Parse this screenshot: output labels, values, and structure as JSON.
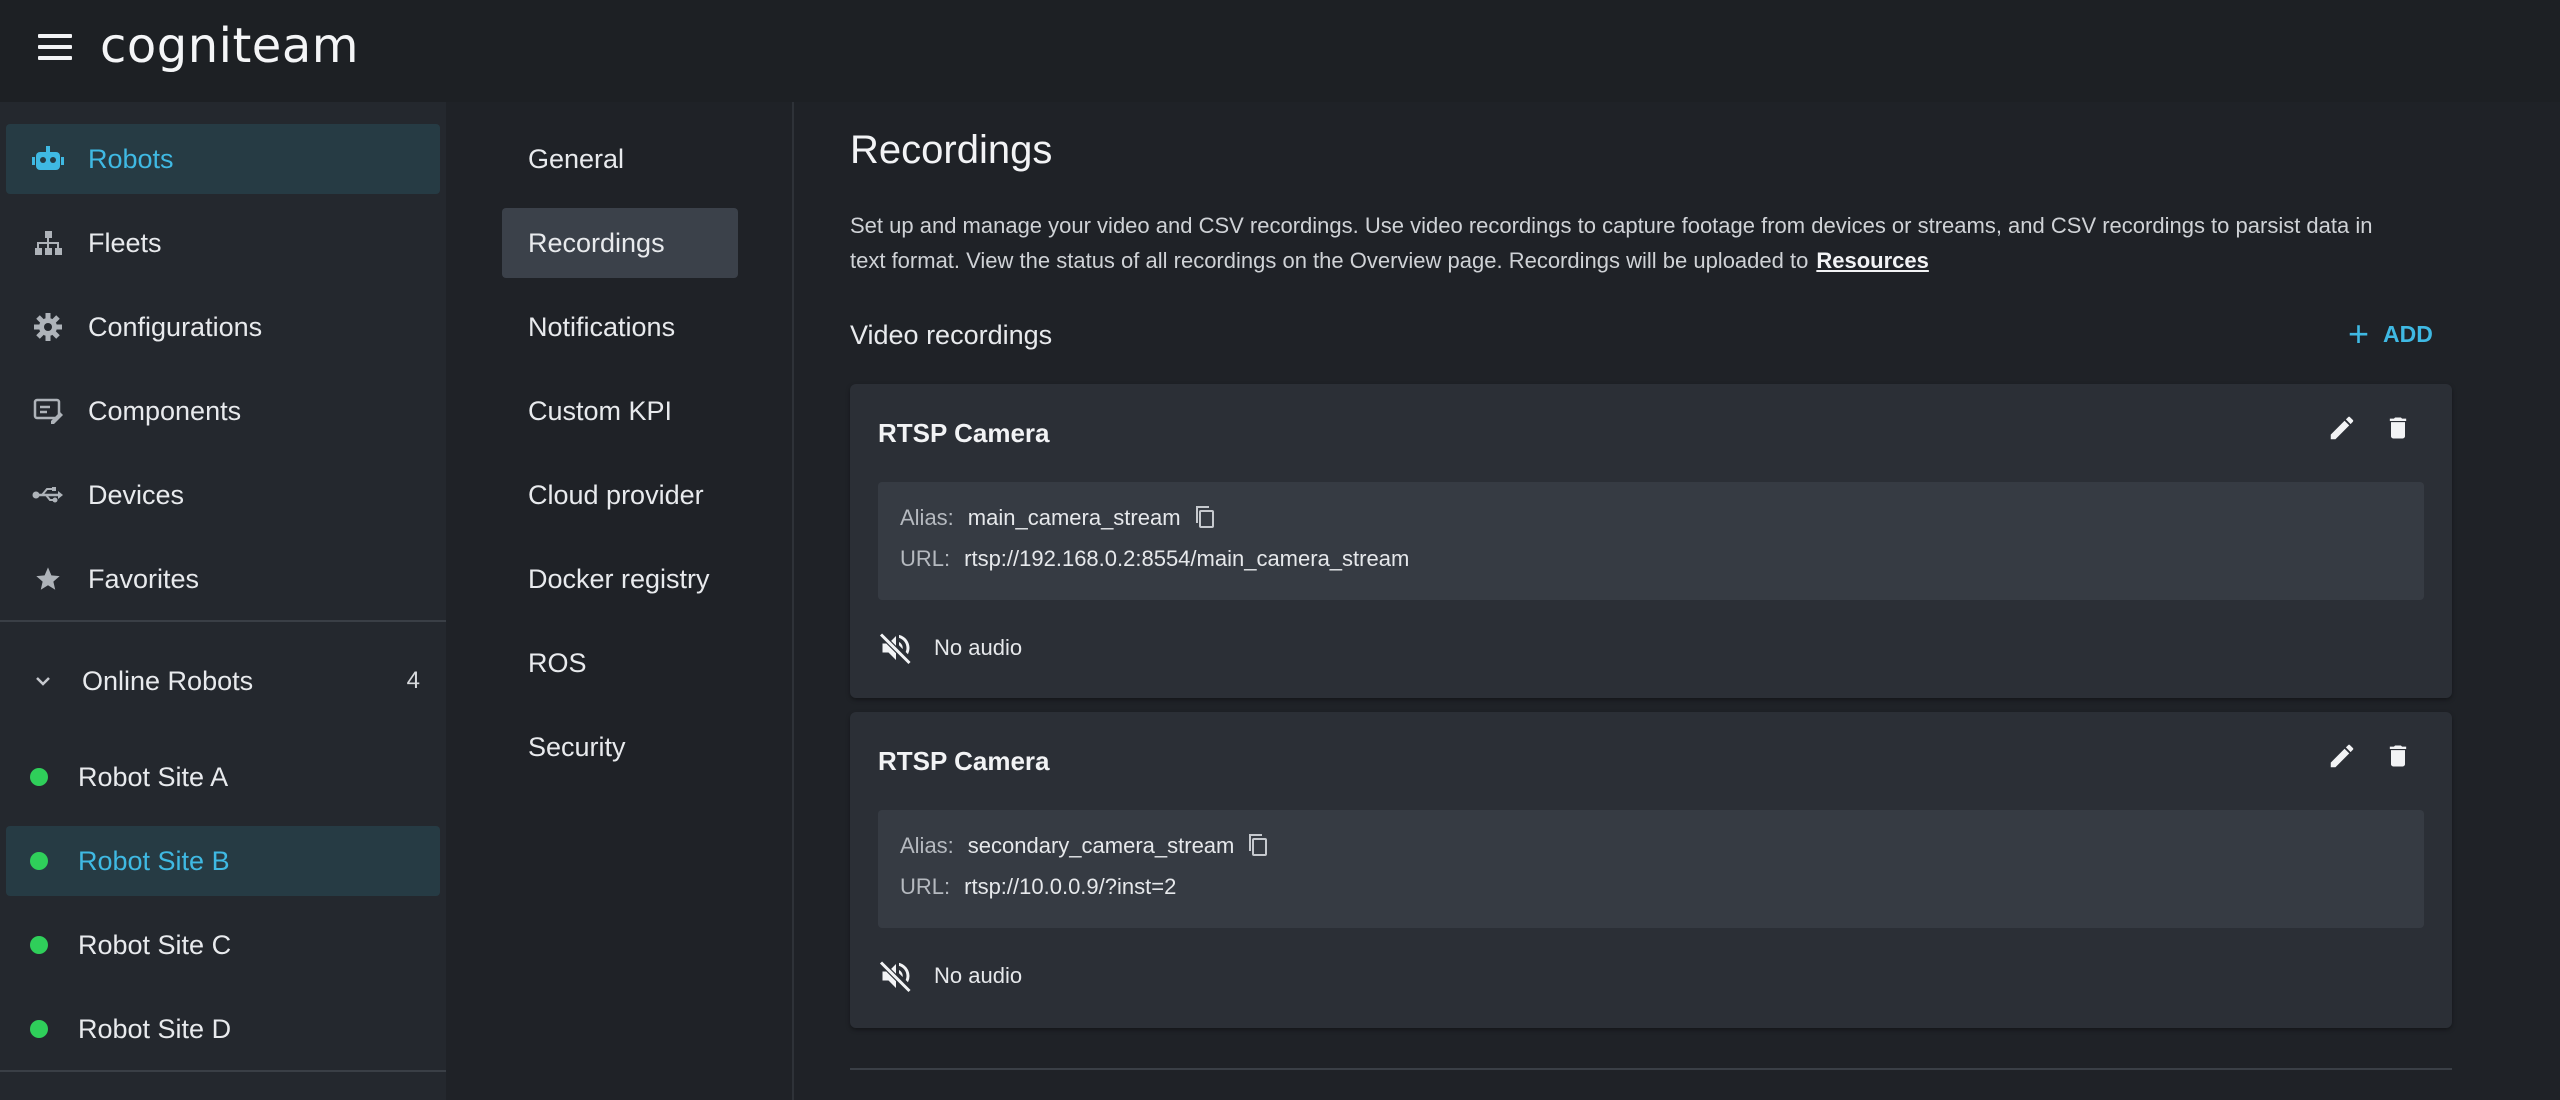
{
  "app": {
    "logo": "cogniteam"
  },
  "sidebar": {
    "items": [
      {
        "label": "Robots",
        "icon": "robot-icon",
        "active": true
      },
      {
        "label": "Fleets",
        "icon": "fleet-icon"
      },
      {
        "label": "Configurations",
        "icon": "gear-icon"
      },
      {
        "label": "Components",
        "icon": "component-icon"
      },
      {
        "label": "Devices",
        "icon": "usb-icon"
      },
      {
        "label": "Favorites",
        "icon": "star-icon"
      }
    ],
    "group": {
      "label": "Online Robots",
      "count": "4"
    },
    "sites": [
      {
        "label": "Robot Site A"
      },
      {
        "label": "Robot Site B",
        "active": true
      },
      {
        "label": "Robot Site C"
      },
      {
        "label": "Robot Site D"
      }
    ],
    "status_color": "#2fcf5a",
    "accent": "#3fb9e3"
  },
  "subnav": {
    "items": [
      {
        "label": "General"
      },
      {
        "label": "Recordings",
        "active": true
      },
      {
        "label": "Notifications"
      },
      {
        "label": "Custom KPI"
      },
      {
        "label": "Cloud provider"
      },
      {
        "label": "Docker registry"
      },
      {
        "label": "ROS"
      },
      {
        "label": "Security"
      }
    ]
  },
  "main": {
    "title": "Recordings",
    "description_line1": "Set up and manage your video and CSV recordings. Use video recordings to capture footage from devices or streams, and CSV recordings to parsist data in",
    "description_line2": "text format. View the status of all recordings on the Overview page. Recordings will be uploaded to",
    "description_link": "Resources",
    "section_title": "Video recordings",
    "add_label": "ADD",
    "recordings": [
      {
        "title": "RTSP Camera",
        "alias_key": "Alias:",
        "alias": "main_camera_stream",
        "url_key": "URL:",
        "url": "rtsp://192.168.0.2:8554/main_camera_stream",
        "audio": "No audio"
      },
      {
        "title": "RTSP Camera",
        "alias_key": "Alias:",
        "alias": "secondary_camera_stream",
        "url_key": "URL:",
        "url": "rtsp://10.0.0.9/?inst=2",
        "audio": "No audio"
      }
    ]
  }
}
